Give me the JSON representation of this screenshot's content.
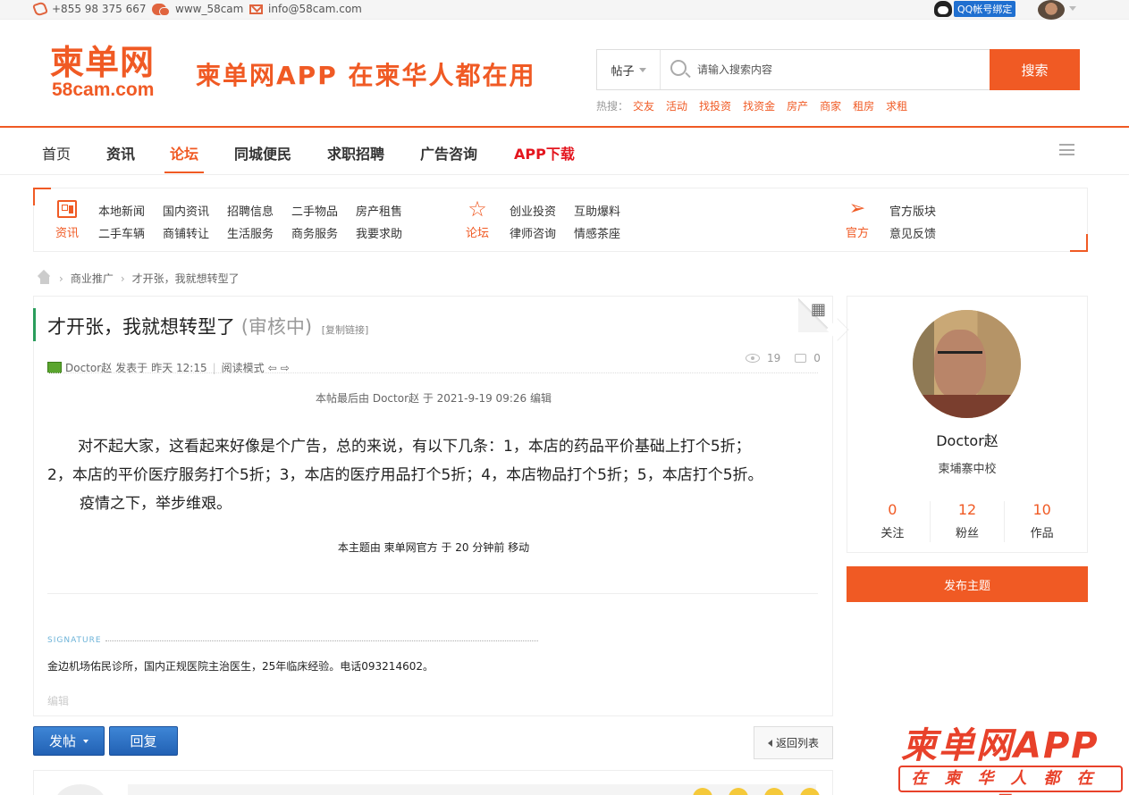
{
  "topbar": {
    "phone": "+855 98 375 667",
    "wechat": "www_58cam",
    "email": "info@58cam.com",
    "qq_bind": "QQ帐号绑定"
  },
  "header": {
    "logo_text": "柬单网",
    "logo_domain": "58cam.com",
    "slogan": "柬单网APP 在柬华人都在用",
    "search_type": "帖子",
    "search_placeholder": "请输入搜索内容",
    "search_button": "搜索",
    "hot_label": "热搜：",
    "hot_terms": [
      "交友",
      "活动",
      "找投资",
      "找资金",
      "房产",
      "商家",
      "租房",
      "求租"
    ]
  },
  "nav": {
    "items": [
      "首页",
      "资讯",
      "论坛",
      "同城便民",
      "求职招聘",
      "广告咨询",
      "APP下载"
    ],
    "active": "论坛"
  },
  "categories": {
    "news": {
      "head": "资讯",
      "row1": [
        "本地新闻",
        "国内资讯",
        "招聘信息",
        "二手物品",
        "房产租售"
      ],
      "row2": [
        "二手车辆",
        "商铺转让",
        "生活服务",
        "商务服务",
        "我要求助"
      ]
    },
    "forum": {
      "head": "论坛",
      "row1": [
        "创业投资",
        "互助爆料"
      ],
      "row2": [
        "律师咨询",
        "情感茶座"
      ]
    },
    "official": {
      "head": "官方",
      "row1": [
        "官方版块"
      ],
      "row2": [
        "意见反馈"
      ]
    }
  },
  "breadcrumb": [
    "商业推广",
    "才开张，我就想转型了"
  ],
  "post": {
    "title": "才开张，我就想转型了",
    "status": "(审核中)",
    "copy_link": "[复制链接]",
    "author": "Doctor赵",
    "posted_label": "发表于",
    "posted_time": "昨天 12:15",
    "read_mode": "阅读模式",
    "views": "19",
    "replies": "0",
    "edited_note": "本帖最后由 Doctor赵 于 2021-9-19 09:26 编辑",
    "body_line1": "对不起大家，这看起来好像是个广告，总的来说，有以下几条：1，本店的药品平价基础上打个5折；",
    "body_line2": "2，本店的平价医疗服务打个5折；3，本店的医疗用品打个5折；4，本店物品打个5折；5，本店打个5折。",
    "body_line3": "疫情之下，举步维艰。",
    "moved_note": "本主题由 柬单网官方 于 20 分钟前 移动",
    "signature_label": "SIGNATURE",
    "signature_text": "金边机场佑民诊所，国内正规医院主治医生，25年临床经验。电话093214602。",
    "edit_link": "编辑"
  },
  "actions": {
    "post_button": "发帖",
    "reply_button": "回复",
    "back_button": "返回列表"
  },
  "sidebar": {
    "name": "Doctor赵",
    "location": "柬埔寨中校",
    "follow_count": "0",
    "follow_label": "关注",
    "fans_count": "12",
    "fans_label": "粉丝",
    "works_count": "10",
    "works_label": "作品",
    "publish_button": "发布主题"
  },
  "app_ad": {
    "line1": "柬单网APP",
    "line2": "在柬华人都在用"
  },
  "colors": {
    "brand": "#f05a24",
    "button_blue": "#2261b4",
    "accent_green": "#2a9d5c"
  }
}
